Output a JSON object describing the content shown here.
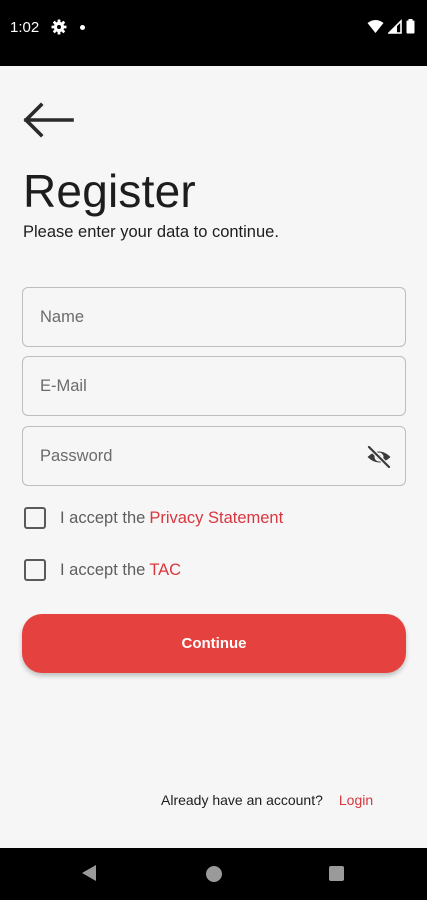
{
  "status_bar": {
    "time": "1:02",
    "icons": [
      "gear-icon",
      "notification-dot-icon",
      "wifi-icon",
      "cell-signal-icon",
      "battery-icon"
    ]
  },
  "header": {
    "back_icon": "arrow-left-icon",
    "title": "Register",
    "subtitle": "Please enter your data to continue."
  },
  "form": {
    "name_placeholder": "Name",
    "email_placeholder": "E-Mail",
    "password_placeholder": "Password",
    "password_toggle_icon": "eye-off-icon"
  },
  "consents": {
    "privacy_prefix": "I accept the",
    "privacy_link": "Privacy Statement",
    "tac_prefix": "I accept the",
    "tac_link": "TAC"
  },
  "actions": {
    "continue_label": "Continue"
  },
  "footer": {
    "account_text": "Already have an account?",
    "login_link": "Login"
  },
  "nav_bar": {
    "icons": [
      "back-triangle-icon",
      "home-circle-icon",
      "recents-square-icon"
    ]
  },
  "colors": {
    "accent": "#e5413e",
    "link": "#d9363e",
    "background": "#f6f6f6",
    "text": "#1d1d1d"
  }
}
